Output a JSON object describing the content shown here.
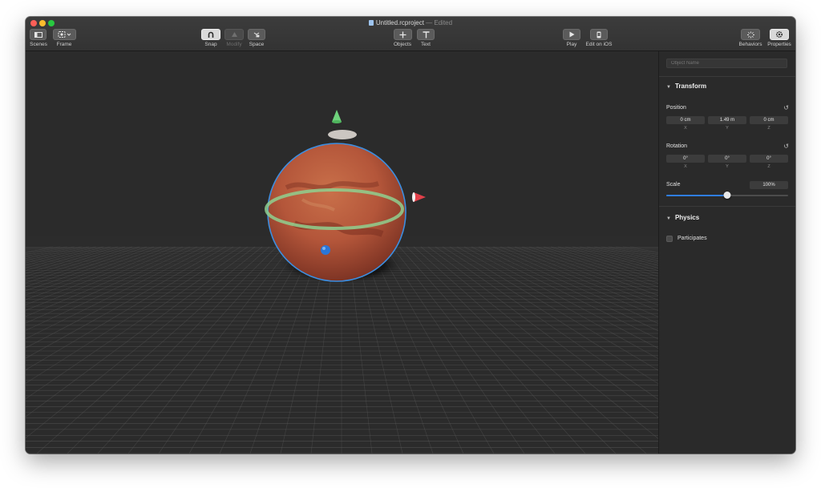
{
  "window": {
    "title": "Untitled.rcproject",
    "edited": "— Edited"
  },
  "toolbar": {
    "scenes_label": "Scenes",
    "frame_label": "Frame",
    "snap_label": "Snap",
    "modify_label": "Modify",
    "space_label": "Space",
    "objects_label": "Objects",
    "text_label": "Text",
    "play_label": "Play",
    "edit_ios_label": "Edit on iOS",
    "behaviors_label": "Behaviors",
    "properties_label": "Properties"
  },
  "inspector": {
    "object_name_placeholder": "Object Name",
    "transform": {
      "title": "Transform",
      "position_label": "Position",
      "position": {
        "x": "0 cm",
        "y": "1.49 m",
        "z": "0 cm"
      },
      "rotation_label": "Rotation",
      "rotation": {
        "x": "0°",
        "y": "0°",
        "z": "0°"
      },
      "axis_x": "X",
      "axis_y": "Y",
      "axis_z": "Z",
      "scale_label": "Scale",
      "scale_value": "100%",
      "scale_slider_fraction": 0.5
    },
    "physics": {
      "title": "Physics",
      "participates_label": "Participates",
      "participates_checked": false
    }
  },
  "colors": {
    "accent": "#2f7de1",
    "gizmo_y": "#6fd37c",
    "gizmo_x": "#e2404a",
    "gizmo_z": "#2a76d8",
    "selection_outline": "#3c8ee0",
    "planet": "#b4563a"
  },
  "icons": {
    "scenes": "sidebar-icon",
    "frame": "frame-icon",
    "snap": "magnet-icon",
    "modify": "modify-icon",
    "space": "space-icon",
    "objects": "plus-icon",
    "text": "text-icon",
    "play": "play-icon",
    "edit_ios": "phone-icon",
    "behaviors": "sparkle-icon",
    "properties": "gear-icon"
  }
}
